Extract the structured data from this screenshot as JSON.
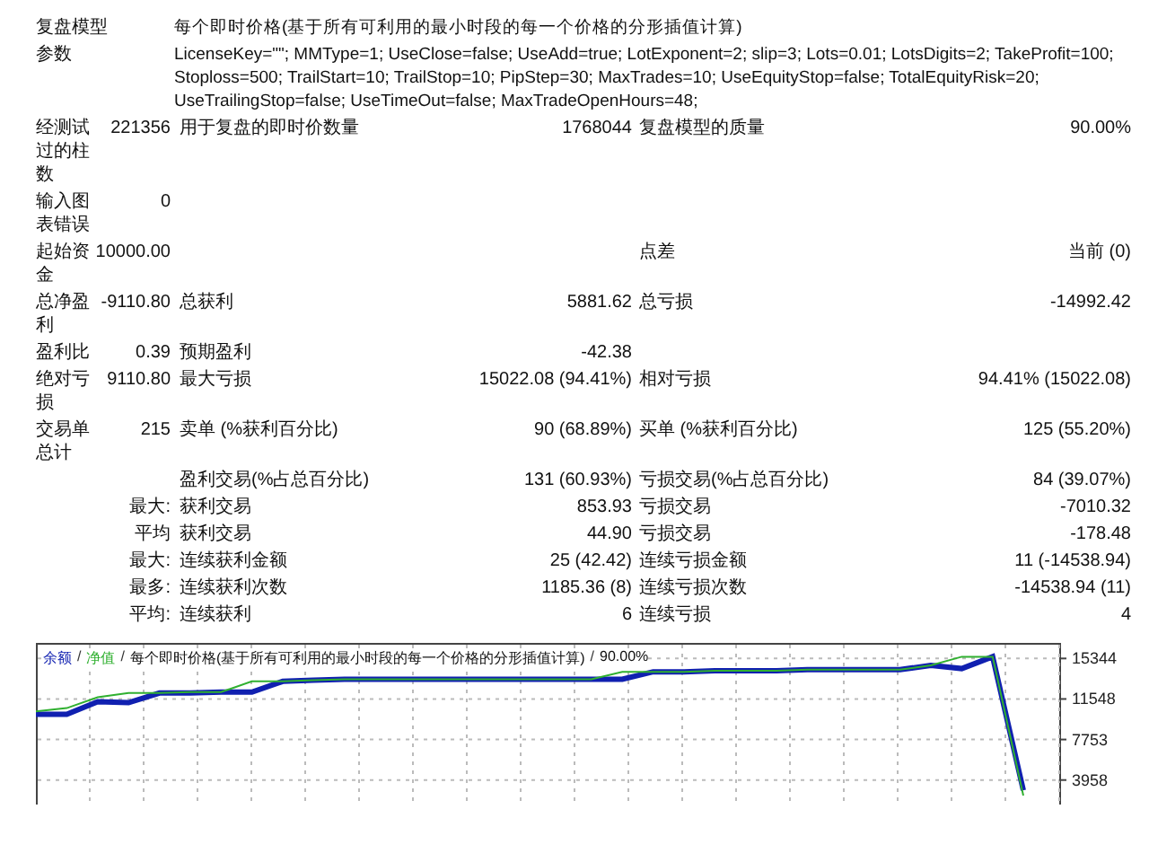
{
  "report": {
    "rows": [
      {
        "kind": "span",
        "label": "复盘模型",
        "text": "每个即时价格(基于所有可利用的最小时段的每一个价格的分形插值计算)"
      },
      {
        "kind": "span",
        "label": "参数",
        "text": "LicenseKey=\"\"; MMType=1; UseClose=false; UseAdd=true; LotExponent=2; slip=3; Lots=0.01; LotsDigits=2; TakeProfit=100; Stoploss=500; TrailStart=10; TrailStop=10; PipStep=30; MaxTrades=10; UseEquityStop=false; TotalEquityRisk=20; UseTrailingStop=false; UseTimeOut=false; MaxTradeOpenHours=48;"
      },
      {
        "kind": "grid",
        "cells": [
          "经测试过的柱数",
          "221356",
          "用于复盘的即时价数量",
          "1768044",
          "复盘模型的质量",
          "90.00%"
        ]
      },
      {
        "kind": "grid",
        "cells": [
          "输入图表错误",
          "0",
          "",
          "",
          "",
          ""
        ]
      },
      {
        "kind": "grid",
        "cells": [
          "起始资金",
          "10000.00",
          "",
          "",
          "点差",
          "当前 (0)"
        ]
      },
      {
        "kind": "grid",
        "cells": [
          "总净盈利",
          "-9110.80",
          "总获利",
          "5881.62",
          "总亏损",
          "-14992.42"
        ]
      },
      {
        "kind": "grid",
        "cells": [
          "盈利比",
          "0.39",
          "预期盈利",
          "-42.38",
          "",
          ""
        ]
      },
      {
        "kind": "grid",
        "cells": [
          "绝对亏损",
          "9110.80",
          "最大亏损",
          "15022.08 (94.41%)",
          "相对亏损",
          "94.41% (15022.08)"
        ]
      },
      {
        "kind": "grid",
        "cells": [
          "交易单总计",
          "215",
          "卖单 (%获利百分比)",
          "90 (68.89%)",
          "买单 (%获利百分比)",
          "125 (55.20%)"
        ]
      },
      {
        "kind": "grid",
        "cells": [
          "",
          "",
          "盈利交易(%占总百分比)",
          "131 (60.93%)",
          "亏损交易(%占总百分比)",
          "84 (39.07%)"
        ]
      },
      {
        "kind": "grid",
        "cells": [
          "",
          "最大:",
          "获利交易",
          "853.93",
          "亏损交易",
          "-7010.32"
        ]
      },
      {
        "kind": "grid",
        "cells": [
          "",
          "平均",
          "获利交易",
          "44.90",
          "亏损交易",
          "-178.48"
        ]
      },
      {
        "kind": "grid",
        "cells": [
          "",
          "最大:",
          "连续获利金额",
          "25 (42.42)",
          "连续亏损金额",
          "11 (-14538.94)"
        ]
      },
      {
        "kind": "grid",
        "cells": [
          "",
          "最多:",
          "连续获利次数",
          "1185.36 (8)",
          "连续亏损次数",
          "-14538.94 (11)"
        ]
      },
      {
        "kind": "grid",
        "cells": [
          "",
          "平均:",
          "连续获利",
          "6",
          "连续亏损",
          "4"
        ]
      }
    ]
  },
  "chart": {
    "legend_note": "每个即时价格(基于所有可利用的最小时段的每一个价格的分形插值计算)",
    "quality": "90.00%",
    "legend_separator": "/",
    "chart_data": {
      "type": "line",
      "grid": true,
      "ylim": [
        2000,
        16800
      ],
      "yticks": [
        3958,
        7753,
        11548,
        15344
      ],
      "series": [
        {
          "name": "余额",
          "color": "#1020b0",
          "values": [
            10100,
            10100,
            11300,
            11200,
            12100,
            12100,
            12200,
            12200,
            13200,
            13300,
            13400,
            13400,
            13400,
            13400,
            13400,
            13400,
            13400,
            13400,
            13400,
            13400,
            14100,
            14100,
            14200,
            14200,
            14200,
            14300,
            14300,
            14300,
            14300,
            14700,
            14400,
            15500,
            3000
          ]
        },
        {
          "name": "净值",
          "color": "#30b030",
          "values": [
            10400,
            10700,
            11700,
            12100,
            12100,
            12200,
            12200,
            13200,
            13200,
            13300,
            13400,
            13400,
            13400,
            13400,
            13400,
            13400,
            13400,
            13400,
            13400,
            14100,
            14100,
            14100,
            14200,
            14200,
            14200,
            14300,
            14300,
            14300,
            14300,
            14700,
            15500,
            15500,
            2500
          ]
        }
      ]
    }
  }
}
